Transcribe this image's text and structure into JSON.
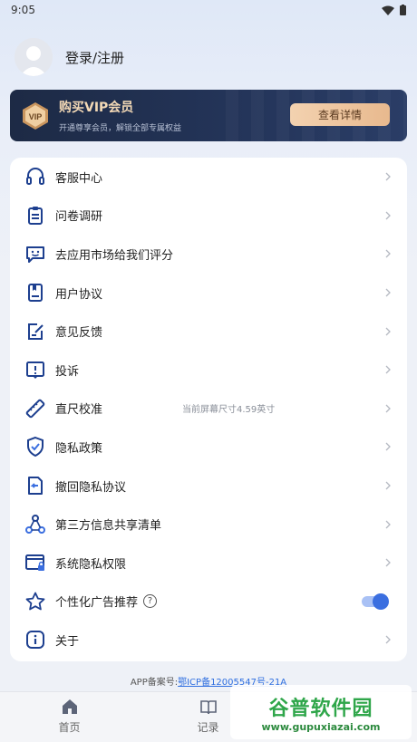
{
  "status": {
    "time": "9:05"
  },
  "profile": {
    "login_label": "登录/注册"
  },
  "vip": {
    "badge_text": "VIP",
    "title": "购买VIP会员",
    "subtitle": "开通尊享会员，解锁全部专属权益",
    "button_label": "查看详情"
  },
  "menu": {
    "items": [
      {
        "label": "客服中心",
        "icon": "headset-icon"
      },
      {
        "label": "问卷调研",
        "icon": "clipboard-icon"
      },
      {
        "label": "去应用市场给我们评分",
        "icon": "smile-chat-icon"
      },
      {
        "label": "用户协议",
        "icon": "document-icon"
      },
      {
        "label": "意见反馈",
        "icon": "edit-note-icon"
      },
      {
        "label": "投诉",
        "icon": "report-icon"
      },
      {
        "label": "直尺校准",
        "icon": "ruler-icon",
        "value": "当前屏幕尺寸4.59英寸"
      },
      {
        "label": "隐私政策",
        "icon": "shield-check-icon"
      },
      {
        "label": "撤回隐私协议",
        "icon": "revoke-doc-icon"
      },
      {
        "label": "第三方信息共享清单",
        "icon": "share-nodes-icon"
      },
      {
        "label": "系统隐私权限",
        "icon": "window-lock-icon"
      },
      {
        "label": "个性化广告推荐",
        "icon": "star-icon",
        "help": "?",
        "toggle_on": true
      },
      {
        "label": "关于",
        "icon": "info-icon"
      }
    ]
  },
  "footer": {
    "icp_prefix": "APP备案号:",
    "icp_link": "鄂ICP备12005547号-21A"
  },
  "nav": {
    "home_label": "首页",
    "records_label": "记录"
  },
  "watermark": {
    "title": "谷普软件园",
    "url": "www.gupuxiazai.com"
  },
  "colors": {
    "accent": "#3b6fe0",
    "vip_gold": "#f3d9b6",
    "vip_bg": "#1d2a45"
  }
}
